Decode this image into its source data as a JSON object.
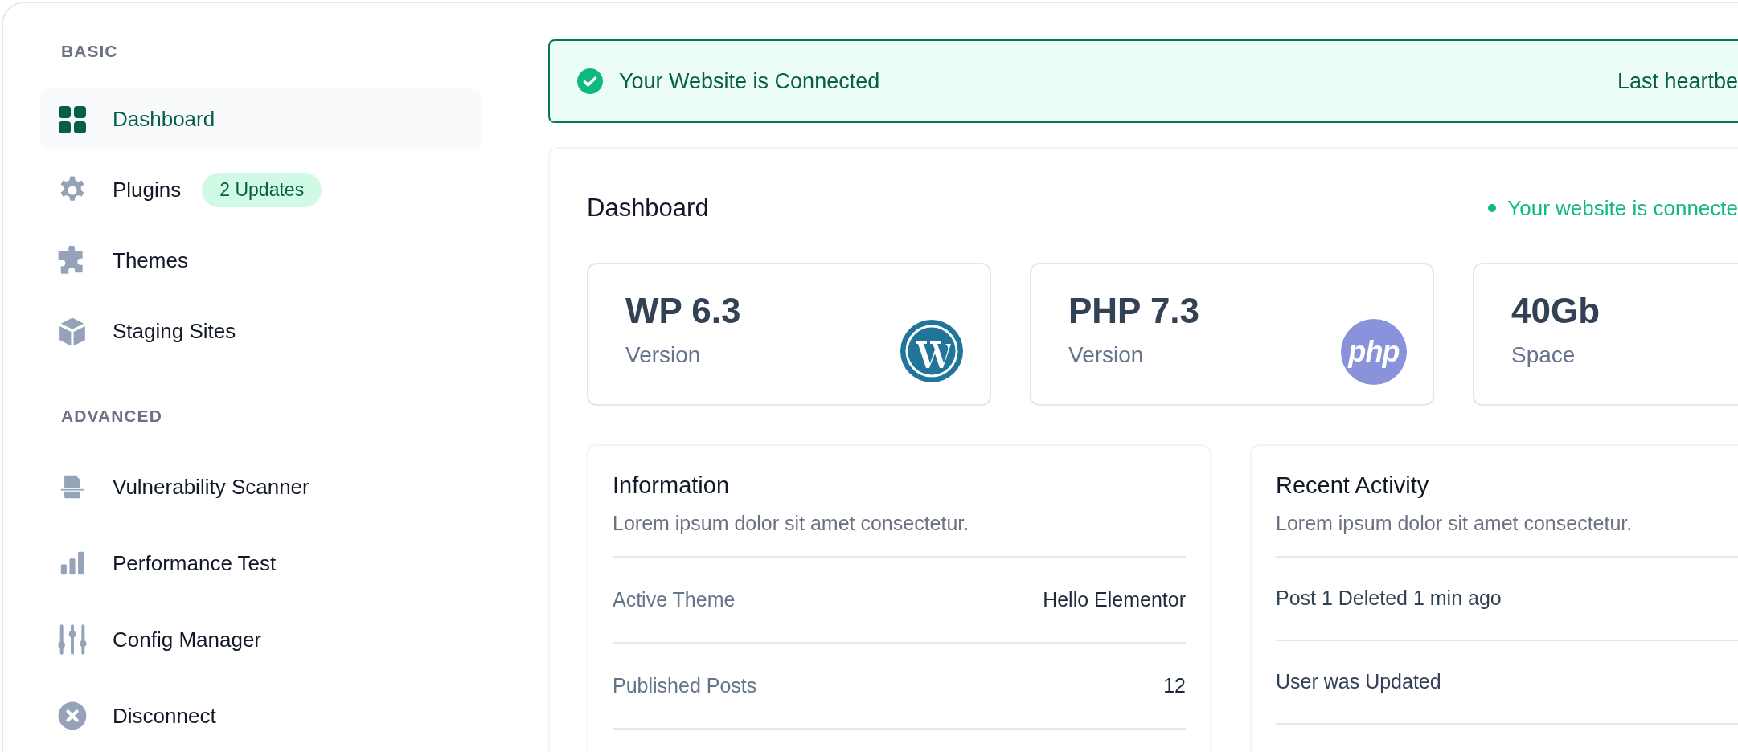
{
  "sidebar": {
    "sections": [
      {
        "heading": "BASIC",
        "items": [
          {
            "label": "Dashboard",
            "kind": "grid",
            "selected": true
          },
          {
            "label": "Plugins",
            "kind": "gear",
            "selected": false,
            "badge": "2 Updates"
          },
          {
            "label": "Themes",
            "kind": "puzzle",
            "selected": false
          },
          {
            "label": "Staging Sites",
            "kind": "cube",
            "selected": false
          }
        ]
      },
      {
        "heading": "ADVANCED",
        "items": [
          {
            "label": "Vulnerability Scanner",
            "kind": "scanner",
            "selected": false
          },
          {
            "label": "Performance Test",
            "kind": "bars",
            "selected": false
          },
          {
            "label": "Config Manager",
            "kind": "sliders",
            "selected": false
          },
          {
            "label": "Disconnect",
            "kind": "xcircle",
            "selected": false
          }
        ]
      }
    ]
  },
  "banner": {
    "message": "Your Website is Connected",
    "heartbeat": "Last heartbe"
  },
  "dashboard": {
    "title": "Dashboard",
    "status": "Your website is connecte",
    "stats": [
      {
        "value": "WP 6.3",
        "label": "Version",
        "kind": "wordpress"
      },
      {
        "value": "PHP 7.3",
        "label": "Version",
        "kind": "php",
        "logo_text": "php"
      },
      {
        "value": "40Gb",
        "label": "Space",
        "kind": "plain"
      }
    ],
    "information": {
      "title": "Information",
      "subtitle": "Lorem ipsum dolor sit amet consectetur.",
      "rows": [
        {
          "label": "Active Theme",
          "value": "Hello Elementor"
        },
        {
          "label": "Published Posts",
          "value": "12"
        }
      ]
    },
    "recent_activity": {
      "title": "Recent Activity",
      "subtitle": "Lorem ipsum dolor sit amet consectetur.",
      "items": [
        "Post 1 Deleted 1 min ago",
        "User was Updated"
      ]
    }
  }
}
